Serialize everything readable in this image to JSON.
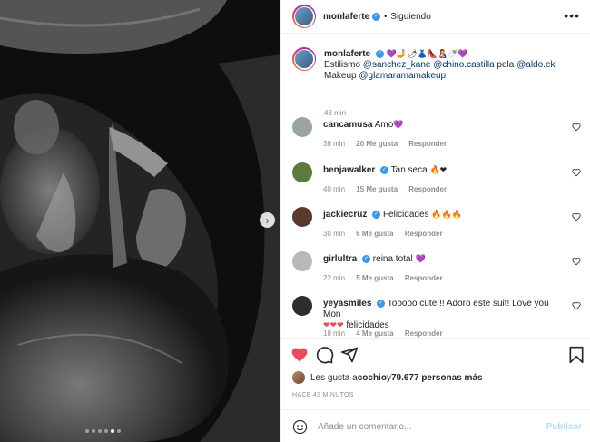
{
  "post": {
    "image_alt": "ultrasound",
    "carousel_dots": 6,
    "carousel_active": 4
  },
  "header": {
    "username": "monlaferte",
    "separator": "•",
    "follow_status": "Siguiendo",
    "more_icon": "more-horizontal-icon"
  },
  "caption": {
    "username": "monlaferte",
    "emojis": "💜🤳🌶👗👠🤱🍼💜",
    "line1_prefix": "Estilismo ",
    "mention1": "@sanchez_kane",
    "mention2": "@chino.castilla",
    "pela": " pela ",
    "mention3": "@aldo.ek",
    "line2_prefix": "Makeup ",
    "mention4": "@glamaramamakeup",
    "time": "43 min"
  },
  "comments": [
    {
      "username": "cancamusa",
      "verified": false,
      "text": "Amo",
      "emoji": "💜",
      "time": "38 min",
      "likes": "20 Me gusta",
      "reply": "Responder",
      "avatar_color": "#9aa5a0"
    },
    {
      "username": "benjawalker",
      "verified": true,
      "text": "Tan seca",
      "emoji": "🔥❤",
      "time": "40 min",
      "likes": "15 Me gusta",
      "reply": "Responder",
      "avatar_color": "#5c7a3e"
    },
    {
      "username": "jackiecruz",
      "verified": true,
      "text": "Felicidades",
      "emoji": "🔥🔥🔥",
      "time": "30 min",
      "likes": "6 Me gusta",
      "reply": "Responder",
      "avatar_color": "#5a3a2e"
    },
    {
      "username": "girlultra",
      "verified": true,
      "text": "reina total",
      "emoji": "💜",
      "time": "22 min",
      "likes": "5 Me gusta",
      "reply": "Responder",
      "avatar_color": "#b8b8b8"
    },
    {
      "username": "yeyasmiles",
      "verified": true,
      "text": "Tooooo cute!!! Adoro este suit! Love you Mon",
      "emoji": "❤❤❤",
      "text2": "felicidades",
      "time": "18 min",
      "likes": "4 Me gusta",
      "reply": "Responder",
      "avatar_color": "#2e2e2e"
    }
  ],
  "actions": {
    "like_icon": "heart-filled-icon",
    "comment_icon": "comment-icon",
    "share_icon": "share-icon",
    "save_icon": "bookmark-icon",
    "like_color": "#ed4956"
  },
  "likes": {
    "prefix": "Les gusta a ",
    "user": "cochio",
    "middle": " y ",
    "count": "79.677 personas más"
  },
  "posted_ago": "HACE 43 MINUTOS",
  "add_comment": {
    "placeholder": "Añade un comentario...",
    "publish_label": "Publicar",
    "emoji_icon": "smile-icon"
  },
  "colors": {
    "accent_blue": "#3897f0",
    "link": "#00376b",
    "muted": "#8e8e8e",
    "publish_disabled": "#b3dbff"
  }
}
